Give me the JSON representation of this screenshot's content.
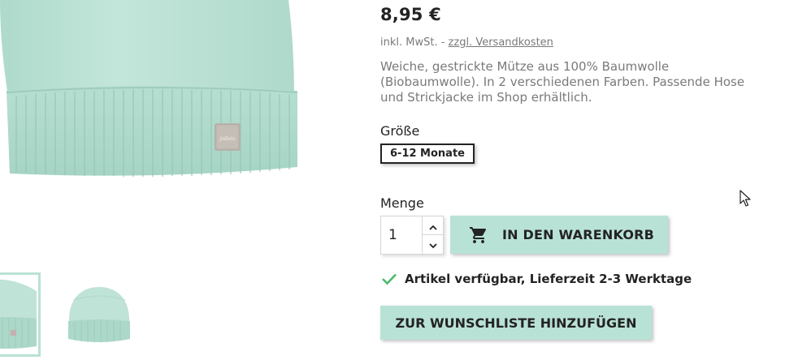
{
  "product": {
    "price": "8,95 €",
    "tax_prefix": "inkl. MwSt. - ",
    "shipping_link": "zzgl. Versandkosten",
    "description": "Weiche, gestrickte Mütze aus 100% Baumwolle (Biobaumwolle). In 2 verschiedenen Farben. Passende Hose und Strickjacke im Shop erhältlich.",
    "image_color": "#bfe3d6",
    "accent_color": "#b9e2d6"
  },
  "variant": {
    "label": "Größe",
    "selected": "6-12 Monate"
  },
  "quantity": {
    "label": "Menge",
    "value": "1",
    "up_icon": "chevron-up-icon",
    "down_icon": "chevron-down-icon"
  },
  "actions": {
    "add_to_cart": "IN DEN WARENKORB",
    "add_to_cart_icon": "shopping-cart-icon",
    "wishlist": "ZUR WUNSCHLISTE HINZUFÜGEN"
  },
  "availability": {
    "icon": "check-icon",
    "text": "Artikel verfügbar, Lieferzeit 2-3 Werktage",
    "color": "#4cbb6c"
  },
  "logo_tag": {
    "text": "jollein"
  }
}
